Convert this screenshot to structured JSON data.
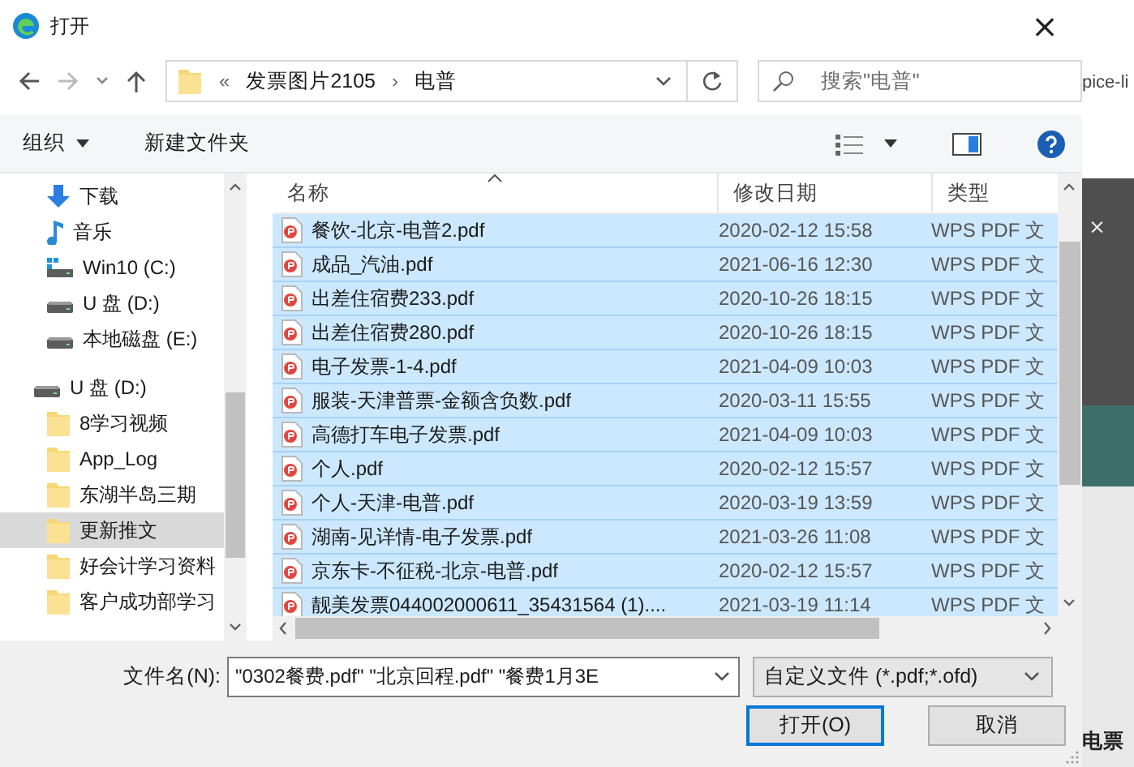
{
  "window": {
    "title": "打开",
    "close": "×"
  },
  "nav": {
    "overflow": "«",
    "path": [
      "发票图片2105",
      "电普"
    ],
    "separator": "›",
    "search": {
      "placeholder": "搜索\"电普\""
    }
  },
  "toolbar": {
    "organize": "组织",
    "new_folder": "新建文件夹"
  },
  "sidebar": {
    "items": [
      {
        "label": "下载",
        "kind": "download",
        "selected": false
      },
      {
        "label": "音乐",
        "kind": "music",
        "selected": false
      },
      {
        "label": "Win10  (C:)",
        "kind": "system-drive",
        "selected": false
      },
      {
        "label": "U 盘 (D:)",
        "kind": "drive",
        "selected": false
      },
      {
        "label": "本地磁盘 (E:)",
        "kind": "drive",
        "selected": false
      },
      {
        "label": "U 盘 (D:)",
        "kind": "drive",
        "selected": false,
        "children": [
          {
            "label": "8学习视频",
            "kind": "folder",
            "selected": false
          },
          {
            "label": "App_Log",
            "kind": "folder",
            "selected": false
          },
          {
            "label": "东湖半岛三期",
            "kind": "folder",
            "selected": false
          },
          {
            "label": "更新推文",
            "kind": "folder",
            "selected": true
          },
          {
            "label": "好会计学习资料",
            "kind": "folder",
            "selected": false
          },
          {
            "label": "客户成功部学习",
            "kind": "folder",
            "selected": false
          }
        ]
      }
    ]
  },
  "table": {
    "columns": [
      {
        "label": "名称",
        "sorted": true
      },
      {
        "label": "修改日期",
        "sorted": false
      },
      {
        "label": "类型",
        "sorted": false
      }
    ],
    "rows": [
      {
        "name": "餐饮-北京-电普2.pdf",
        "date": "2020-02-12 15:58",
        "type": "WPS PDF 文",
        "selected": true
      },
      {
        "name": "成品_汽油.pdf",
        "date": "2021-06-16 12:30",
        "type": "WPS PDF 文",
        "selected": true
      },
      {
        "name": "出差住宿费233.pdf",
        "date": "2020-10-26 18:15",
        "type": "WPS PDF 文",
        "selected": true
      },
      {
        "name": "出差住宿费280.pdf",
        "date": "2020-10-26 18:15",
        "type": "WPS PDF 文",
        "selected": true
      },
      {
        "name": "电子发票-1-4.pdf",
        "date": "2021-04-09 10:03",
        "type": "WPS PDF 文",
        "selected": true
      },
      {
        "name": "服装-天津普票-金额含负数.pdf",
        "date": "2020-03-11 15:55",
        "type": "WPS PDF 文",
        "selected": true
      },
      {
        "name": "高德打车电子发票.pdf",
        "date": "2021-04-09 10:03",
        "type": "WPS PDF 文",
        "selected": true
      },
      {
        "name": "个人.pdf",
        "date": "2020-02-12 15:57",
        "type": "WPS PDF 文",
        "selected": true
      },
      {
        "name": "个人-天津-电普.pdf",
        "date": "2020-03-19 13:59",
        "type": "WPS PDF 文",
        "selected": true
      },
      {
        "name": "湖南-见详情-电子发票.pdf",
        "date": "2021-03-26 11:08",
        "type": "WPS PDF 文",
        "selected": true
      },
      {
        "name": "京东卡-不征税-北京-电普.pdf",
        "date": "2020-02-12 15:57",
        "type": "WPS PDF 文",
        "selected": true
      },
      {
        "name": "靓美发票044002000611_35431564 (1)....",
        "date": "2021-03-19 11:14",
        "type": "WPS PDF 文",
        "selected": true
      }
    ]
  },
  "footer": {
    "filename_label": "文件名(N):",
    "filename": "\"0302餐费.pdf\" \"北京回程.pdf\" \"餐费1月3E",
    "filetype": "自定义文件 (*.pdf;*.ofd)",
    "buttons": [
      {
        "label": "打开(O)",
        "kind": "primary"
      },
      {
        "label": "取消",
        "kind": "normal"
      }
    ]
  },
  "background_app": {
    "texts": [
      "pice-li",
      "×",
      "电票"
    ]
  }
}
